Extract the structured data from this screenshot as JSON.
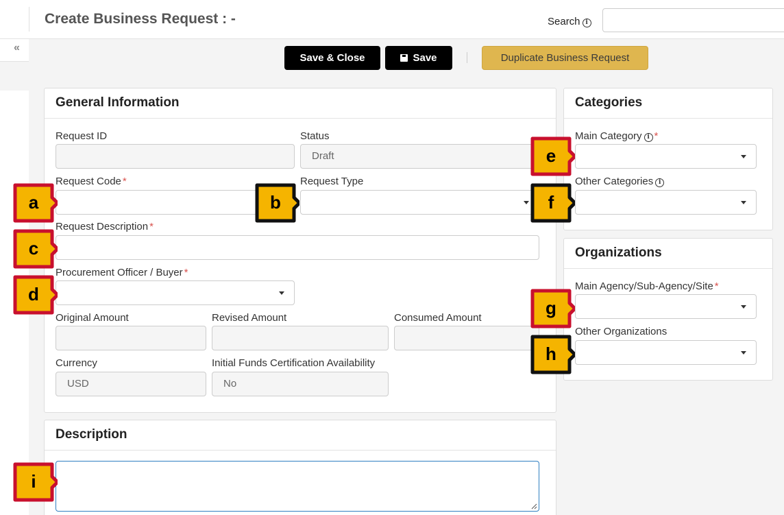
{
  "header": {
    "title": "Create Business Request : -",
    "search_label": "Search",
    "search_value": ""
  },
  "sidebar": {
    "collapse_icon": "«"
  },
  "toolbar": {
    "save_close_label": "Save & Close",
    "save_label": "Save",
    "duplicate_label": "Duplicate Business Request"
  },
  "general": {
    "title": "General Information",
    "request_id_label": "Request ID",
    "request_id_value": "",
    "status_label": "Status",
    "status_value": "Draft",
    "request_code_label": "Request Code",
    "request_type_label": "Request Type",
    "request_description_label": "Request Description",
    "procurement_officer_label": "Procurement Officer / Buyer",
    "original_amount_label": "Original Amount",
    "revised_amount_label": "Revised Amount",
    "consumed_amount_label": "Consumed Amount",
    "currency_label": "Currency",
    "currency_value": "USD",
    "ifc_label": "Initial Funds Certification Availability",
    "ifc_value": "No",
    "required_mark": "*"
  },
  "categories": {
    "title": "Categories",
    "main_category_label": "Main Category",
    "other_categories_label": "Other Categories"
  },
  "organizations": {
    "title": "Organizations",
    "main_agency_label": "Main Agency/Sub-Agency/Site",
    "other_organizations_label": "Other Organizations"
  },
  "description": {
    "title": "Description",
    "value": ""
  },
  "callouts": {
    "a": "a",
    "b": "b",
    "c": "c",
    "d": "d",
    "e": "e",
    "f": "f",
    "g": "g",
    "h": "h",
    "i": "i",
    "red_color": "#c8102e",
    "black_color": "#111111",
    "fill_color": "#f5b400"
  },
  "colors": {
    "gold_button": "#dfb64f",
    "dark_button": "#000000",
    "required": "#d9534f",
    "focus_border": "#2f7fc1"
  }
}
